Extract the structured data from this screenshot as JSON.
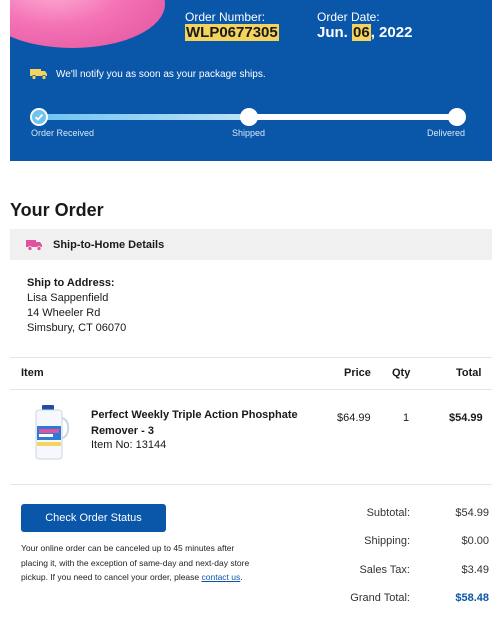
{
  "header": {
    "order_number_label": "Order Number:",
    "order_number_value": "WLP0677305",
    "order_date_label": "Order Date:",
    "order_date_prefix": "Jun. ",
    "order_date_day": "06",
    "order_date_suffix": ", 2022"
  },
  "shipping": {
    "notice": "We'll notify you as soon as your package ships.",
    "progress": 0.5,
    "steps": [
      {
        "label": "Order Received",
        "status": "done"
      },
      {
        "label": "Shipped",
        "status": "pending"
      },
      {
        "label": "Delivered",
        "status": "pending"
      }
    ]
  },
  "order": {
    "title": "Your Order",
    "details_title": "Ship-to-Home Details",
    "ship_to_label": "Ship to Address:",
    "address_lines": [
      "Lisa Sappenfield",
      "14 Wheeler Rd",
      "Simsbury, CT 06070"
    ]
  },
  "table": {
    "headers": {
      "item": "Item",
      "price": "Price",
      "qty": "Qty",
      "total": "Total"
    },
    "items": [
      {
        "name": "Perfect Weekly Triple Action Phosphate Remover - 3",
        "item_no": "Item No: 13144",
        "price": "$64.99",
        "qty": "1",
        "total": "$54.99"
      }
    ]
  },
  "actions": {
    "check_status": "Check Order Status",
    "cancel_note_text": "Your online order can be canceled up to 45 minutes after placing it, with the exception of same-day and next-day store pickup. If you need to cancel your order, please ",
    "contact_link": "contact us",
    "cancel_note_end": "."
  },
  "summary": {
    "subtotal_label": "Subtotal:",
    "subtotal": "$54.99",
    "shipping_label": "Shipping:",
    "shipping": "$0.00",
    "tax_label": "Sales Tax:",
    "tax": "$3.49",
    "grand_label": "Grand Total:",
    "grand": "$58.48"
  },
  "colors": {
    "brand_blue": "#0a56a8",
    "progress_blue": "#6ec3f0",
    "highlight": "#f4d35e",
    "accent_pink": "#e0529c"
  }
}
